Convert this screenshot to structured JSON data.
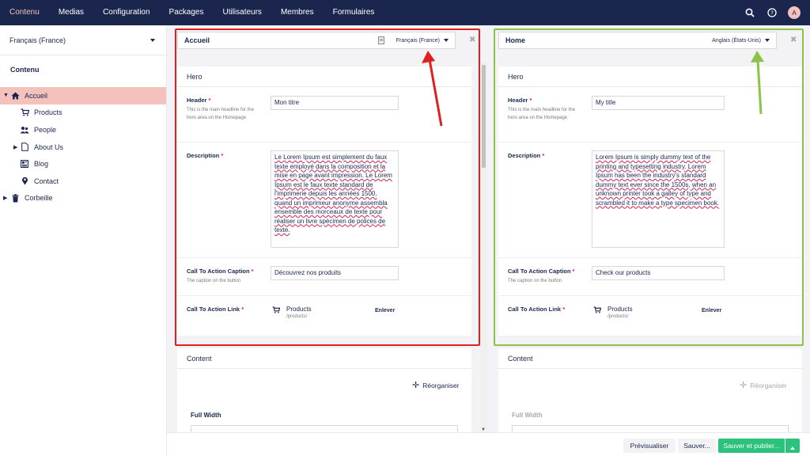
{
  "topnav": {
    "items": [
      "Contenu",
      "Medias",
      "Configuration",
      "Packages",
      "Utilisateurs",
      "Membres",
      "Formulaires"
    ],
    "active_index": 0,
    "avatar_initial": "A"
  },
  "sidebar": {
    "language": "Français (France)",
    "section_title": "Contenu",
    "tree": [
      {
        "label": "Accueil",
        "icon": "home-icon",
        "active": true,
        "expandable": true
      },
      {
        "label": "Products",
        "icon": "cart-icon"
      },
      {
        "label": "People",
        "icon": "people-icon"
      },
      {
        "label": "About Us",
        "icon": "document-icon",
        "expandable": true
      },
      {
        "label": "Blog",
        "icon": "newspaper-icon"
      },
      {
        "label": "Contact",
        "icon": "map-pin-icon"
      },
      {
        "label": "Corbeille",
        "icon": "trash-icon",
        "expandable": true
      }
    ]
  },
  "left_editor": {
    "node_name": "Accueil",
    "culture": "Français (France)",
    "hero_title": "Hero",
    "header_label": "Header",
    "header_desc": "This is the main headline for the hero area on the Homepage",
    "header_value": "Mon titre",
    "description_label": "Description",
    "description_value": "Le Lorem Ipsum est simplement du faux texte employé dans la composition et la mise en page avant impression. Le Lorem Ipsum est le faux texte standard de l'imprimerie depuis les années 1500, quand un imprimeur anonyme assembla ensemble des morceaux de texte pour réaliser un livre spécimen de polices de texte.",
    "cta_caption_label": "Call To Action Caption",
    "cta_caption_desc": "The caption on the button",
    "cta_caption_value": "Découvrez nos produits",
    "cta_link_label": "Call To Action Link",
    "cta_link_name": "Products",
    "cta_link_url": "/products/",
    "remove_label": "Enlever",
    "content_title": "Content",
    "reorganize_label": "Réorganiser",
    "full_width_label": "Full Width"
  },
  "right_editor": {
    "node_name": "Home",
    "culture": "Anglais (États-Unis)",
    "hero_title": "Hero",
    "header_label": "Header",
    "header_desc": "This is the main headline for the hero area on the Homepage",
    "header_value": "My title",
    "description_label": "Description",
    "description_value": "Lorem Ipsum is simply dummy text of the printing and typesetting industry. Lorem Ipsum has been the industry's standard dummy text ever since the 1500s, when an unknown printer took a galley of type and scrambled it to make a type specimen book.",
    "cta_caption_label": "Call To Action Caption",
    "cta_caption_desc": "The caption on the button",
    "cta_caption_value": "Check our products",
    "cta_link_label": "Call To Action Link",
    "cta_link_name": "Products",
    "cta_link_url": "/products/",
    "remove_label": "Enlever",
    "content_title": "Content",
    "reorganize_label": "Réorganiser",
    "full_width_label": "Full Width"
  },
  "footer": {
    "preview_label": "Prévisualiser",
    "save_label": "Sauver...",
    "publish_label": "Sauver et publier..."
  },
  "colors": {
    "nav_bg": "#1b264f",
    "accent_pink": "#f5c1bc",
    "publish_green": "#2bc37c",
    "highlight_red": "#e02020",
    "highlight_green": "#8bc34a"
  }
}
